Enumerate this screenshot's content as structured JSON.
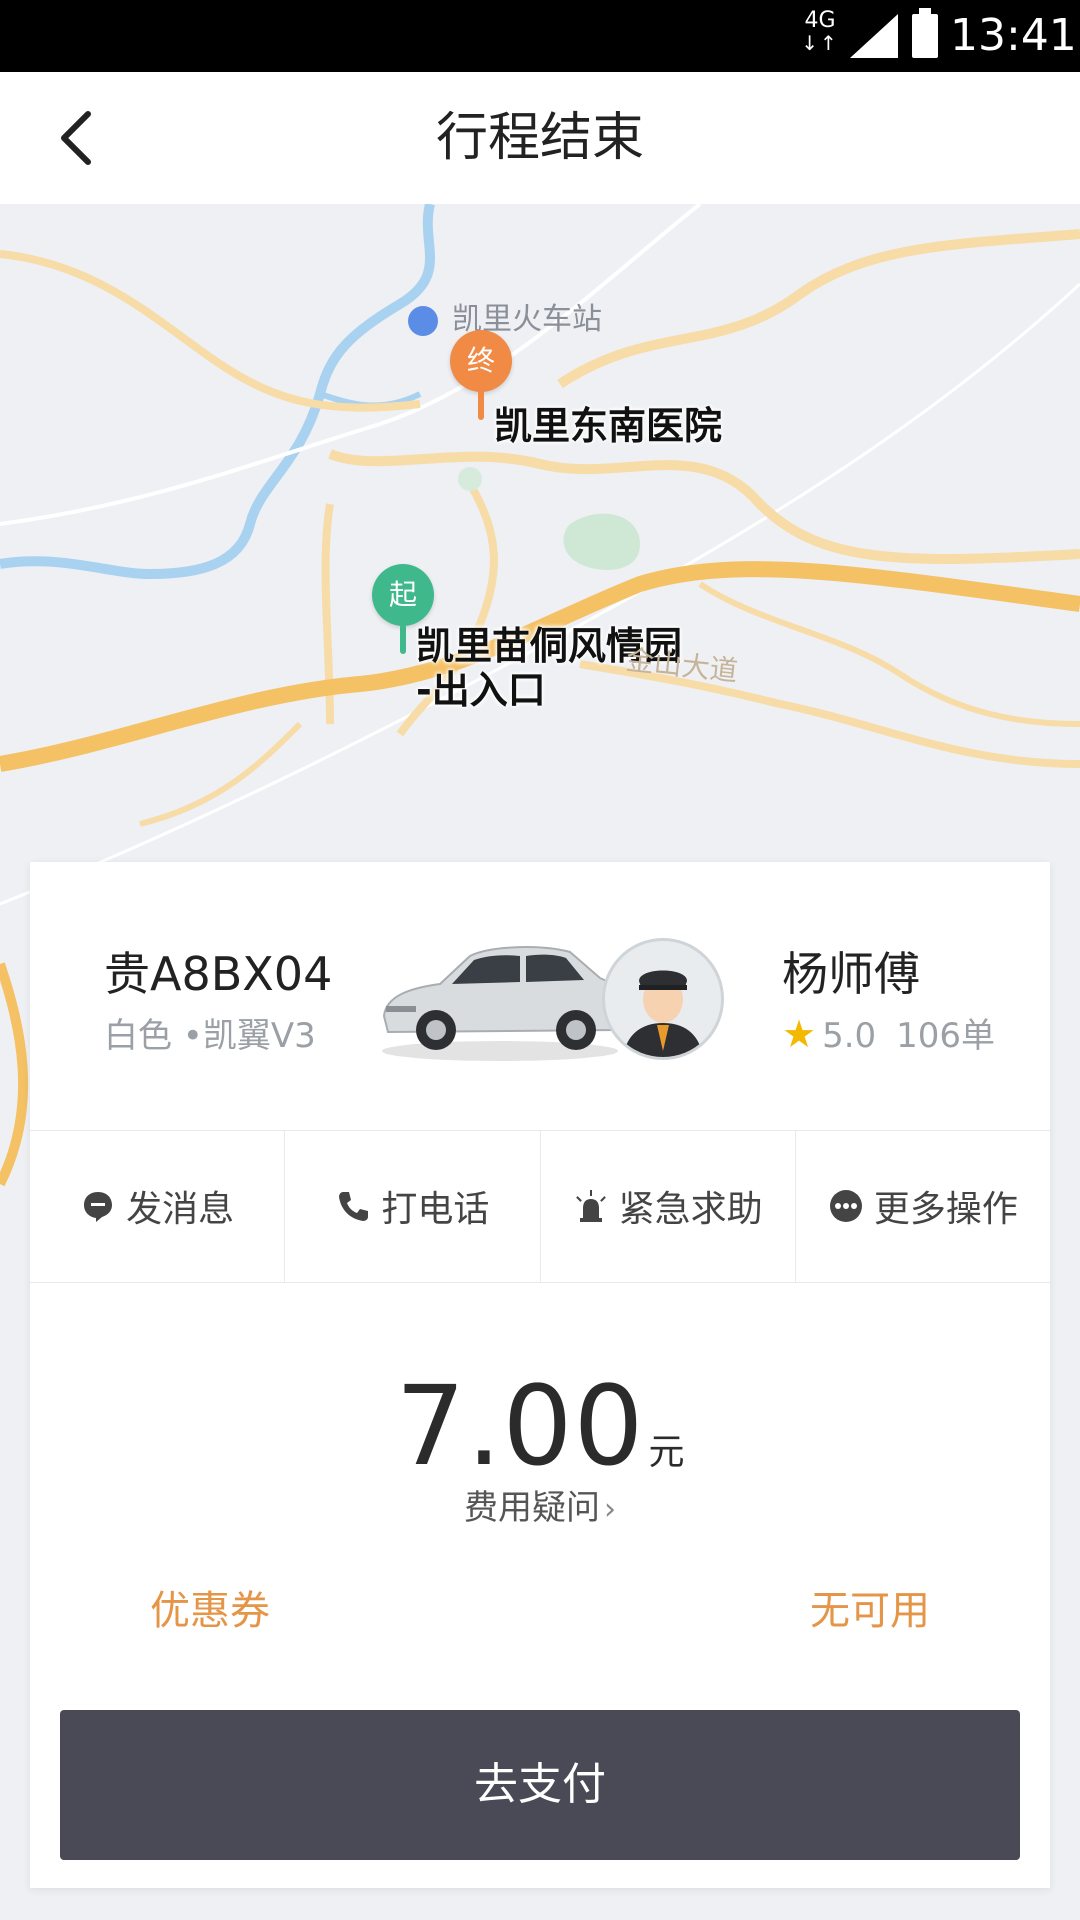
{
  "status_bar": {
    "network": "4G",
    "time": "13:41"
  },
  "header": {
    "title": "行程结束",
    "back_icon": "chevron-left-icon"
  },
  "map": {
    "station": "凯里火车站",
    "end_pin": {
      "text": "终",
      "label": "凯里东南医院",
      "color": "#f08a44"
    },
    "start_pin": {
      "text": "起",
      "label_line1": "凯里苗侗风情园",
      "label_line2": "-出入口",
      "color": "#3fb98b"
    },
    "road": "金山大道"
  },
  "driver_card": {
    "plate": "贵A8BX04",
    "car_desc": "白色 •凯翼V3",
    "driver_name": "杨师傅",
    "rating": "5.0",
    "orders": "106单"
  },
  "actions": [
    {
      "label": "发消息",
      "icon": "chat-bubble-icon"
    },
    {
      "label": "打电话",
      "icon": "phone-icon"
    },
    {
      "label": "紧急求助",
      "icon": "siren-icon"
    },
    {
      "label": "更多操作",
      "icon": "more-dots-icon"
    }
  ],
  "fare": {
    "amount": "7.00",
    "unit": "元",
    "question": "费用疑问"
  },
  "coupon": {
    "label": "优惠券",
    "value": "无可用"
  },
  "pay_button": "去支付",
  "colors": {
    "accent": "#e59547",
    "button": "#4a4a56",
    "start": "#3fb98b",
    "end": "#f08a44"
  }
}
